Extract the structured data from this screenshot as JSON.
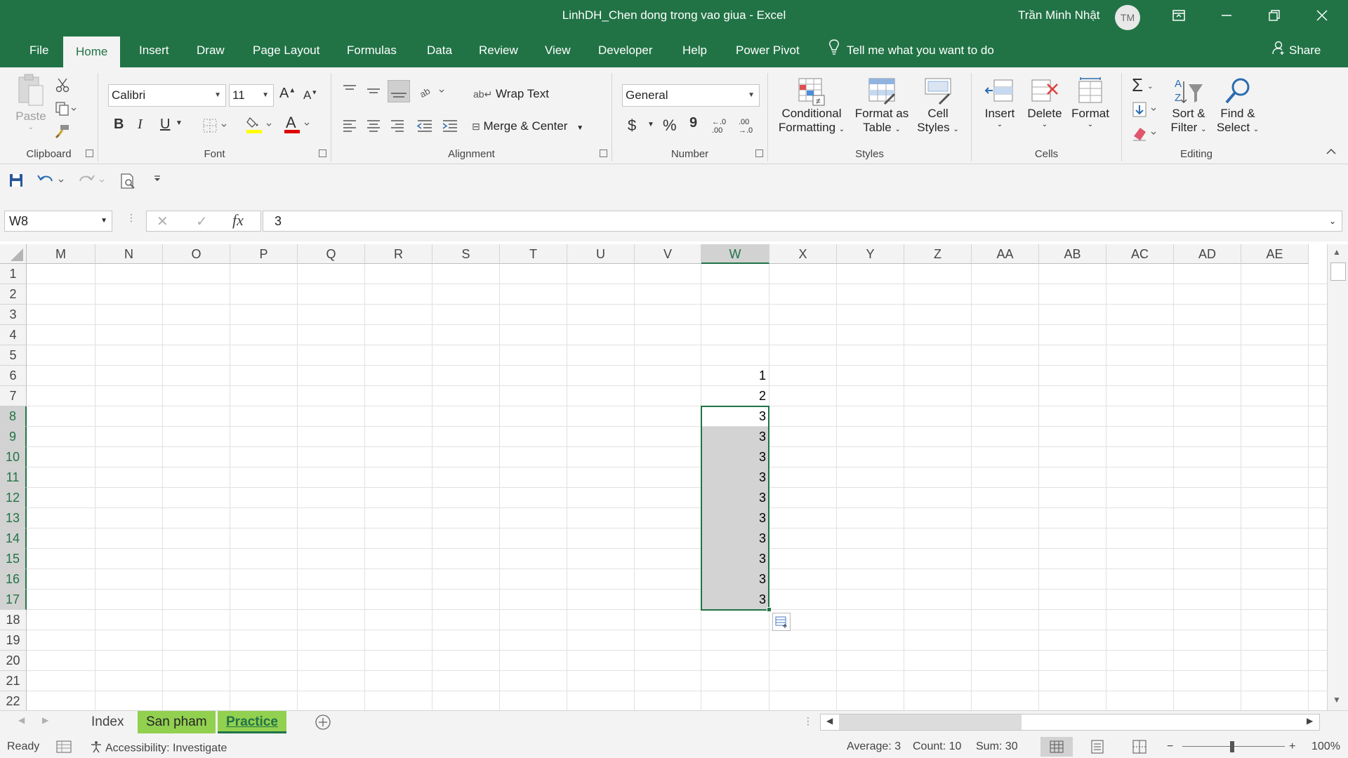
{
  "window": {
    "title": "LinhDH_Chen dong trong vao giua  -  Excel",
    "user_name": "Trần Minh Nhật",
    "user_initials": "TM"
  },
  "tabs": [
    "File",
    "Home",
    "Insert",
    "Draw",
    "Page Layout",
    "Formulas",
    "Data",
    "Review",
    "View",
    "Developer",
    "Help",
    "Power Pivot"
  ],
  "active_tab": "Home",
  "tell_me": "Tell me what you want to do",
  "share_label": "Share",
  "ribbon": {
    "clipboard": {
      "label": "Clipboard",
      "paste": "Paste"
    },
    "font": {
      "label": "Font",
      "font_name": "Calibri",
      "font_size": "11",
      "bold": "B",
      "italic": "I",
      "underline": "U"
    },
    "alignment": {
      "label": "Alignment",
      "wrap_text": "Wrap Text",
      "merge_center": "Merge & Center"
    },
    "number": {
      "label": "Number",
      "format": "General",
      "currency": "$",
      "percent": "%",
      "comma": "9",
      "inc_decimal": "←.0 .00",
      "dec_decimal": ".00 →.0"
    },
    "styles": {
      "label": "Styles",
      "conditional_l1": "Conditional",
      "conditional_l2": "Formatting",
      "format_table_l1": "Format as",
      "format_table_l2": "Table",
      "cell_styles_l1": "Cell",
      "cell_styles_l2": "Styles"
    },
    "cells": {
      "label": "Cells",
      "insert": "Insert",
      "delete": "Delete",
      "format": "Format"
    },
    "editing": {
      "label": "Editing",
      "sort_l1": "Sort &",
      "sort_l2": "Filter",
      "find_l1": "Find &",
      "find_l2": "Select"
    }
  },
  "formula_bar": {
    "name_box": "W8",
    "fx": "fx",
    "value": "3"
  },
  "columns": [
    "M",
    "N",
    "O",
    "P",
    "Q",
    "R",
    "S",
    "T",
    "U",
    "V",
    "W",
    "X",
    "Y",
    "Z",
    "AA",
    "AB",
    "AC",
    "AD",
    "AE"
  ],
  "selected_column": "W",
  "rows": [
    "1",
    "2",
    "3",
    "4",
    "5",
    "6",
    "7",
    "8",
    "9",
    "10",
    "11",
    "12",
    "13",
    "14",
    "15",
    "16",
    "17",
    "18",
    "19",
    "20",
    "21",
    "22"
  ],
  "cells_W": [
    {
      "row": 6,
      "value": "1"
    },
    {
      "row": 7,
      "value": "2"
    },
    {
      "row": 8,
      "value": "3"
    },
    {
      "row": 9,
      "value": "3"
    },
    {
      "row": 10,
      "value": "3"
    },
    {
      "row": 11,
      "value": "3"
    },
    {
      "row": 12,
      "value": "3"
    },
    {
      "row": 13,
      "value": "3"
    },
    {
      "row": 14,
      "value": "3"
    },
    {
      "row": 15,
      "value": "3"
    },
    {
      "row": 16,
      "value": "3"
    },
    {
      "row": 17,
      "value": "3"
    }
  ],
  "selection": {
    "range": "W8:W17",
    "active_cell": "W8"
  },
  "sheets": [
    {
      "name": "Index",
      "color": "none"
    },
    {
      "name": "San pham",
      "color": "#92d050"
    },
    {
      "name": "Practice",
      "color": "#92d050",
      "active": true
    }
  ],
  "status": {
    "ready": "Ready",
    "accessibility": "Accessibility: Investigate",
    "average": "Average: 3",
    "count": "Count: 10",
    "sum": "Sum: 30",
    "zoom": "100%",
    "zoom_minus": "−",
    "zoom_plus": "+"
  },
  "colors": {
    "brand": "#217346",
    "sheet_tab_green": "#92d050",
    "selection_fill": "#d3d3d3"
  }
}
